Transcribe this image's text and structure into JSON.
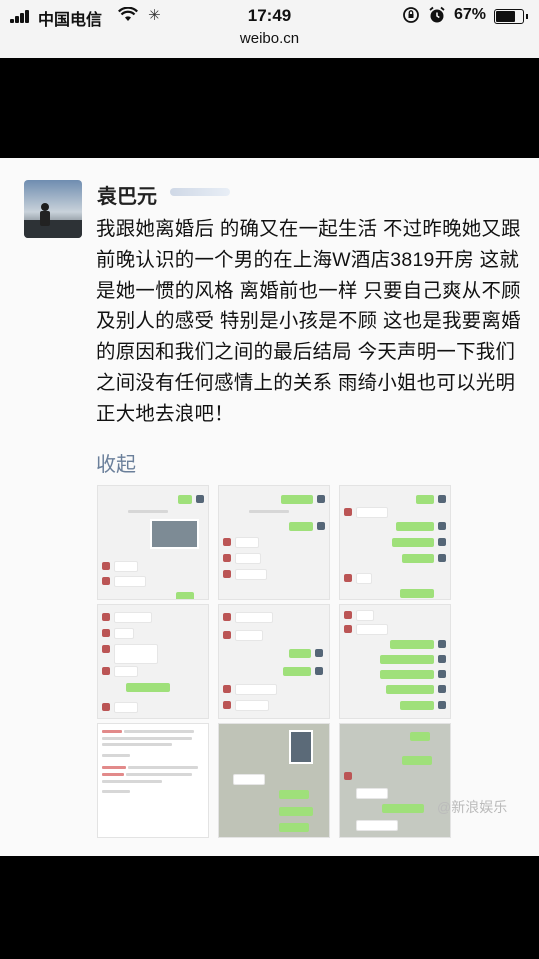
{
  "status_bar": {
    "carrier": "中国电信",
    "time": "17:49",
    "battery_percent": "67%",
    "battery_level": 0.67,
    "icons": [
      "signal-icon",
      "wifi-icon",
      "loading-spinner-icon",
      "rotation-lock-icon",
      "alarm-icon",
      "battery-icon"
    ]
  },
  "browser": {
    "url": "weibo.cn"
  },
  "post": {
    "author": "袁巴元",
    "text": "我跟她离婚后 的确又在一起生活 不过昨晚她又跟前晚认识的一个男的在上海W酒店3819开房 这就是她一惯的风格 离婚前也一样 只要自己爽从不顾及别人的感受 特别是小孩是不顾 这也是我要离婚的原因和我们之间的最后结局 今天声明一下我们之间没有任何感情上的关系 雨绮小姐也可以光明正大地去浪吧！",
    "collapse_label": "收起",
    "image_count": 9
  },
  "watermark": {
    "text": "@新浪娱乐"
  }
}
